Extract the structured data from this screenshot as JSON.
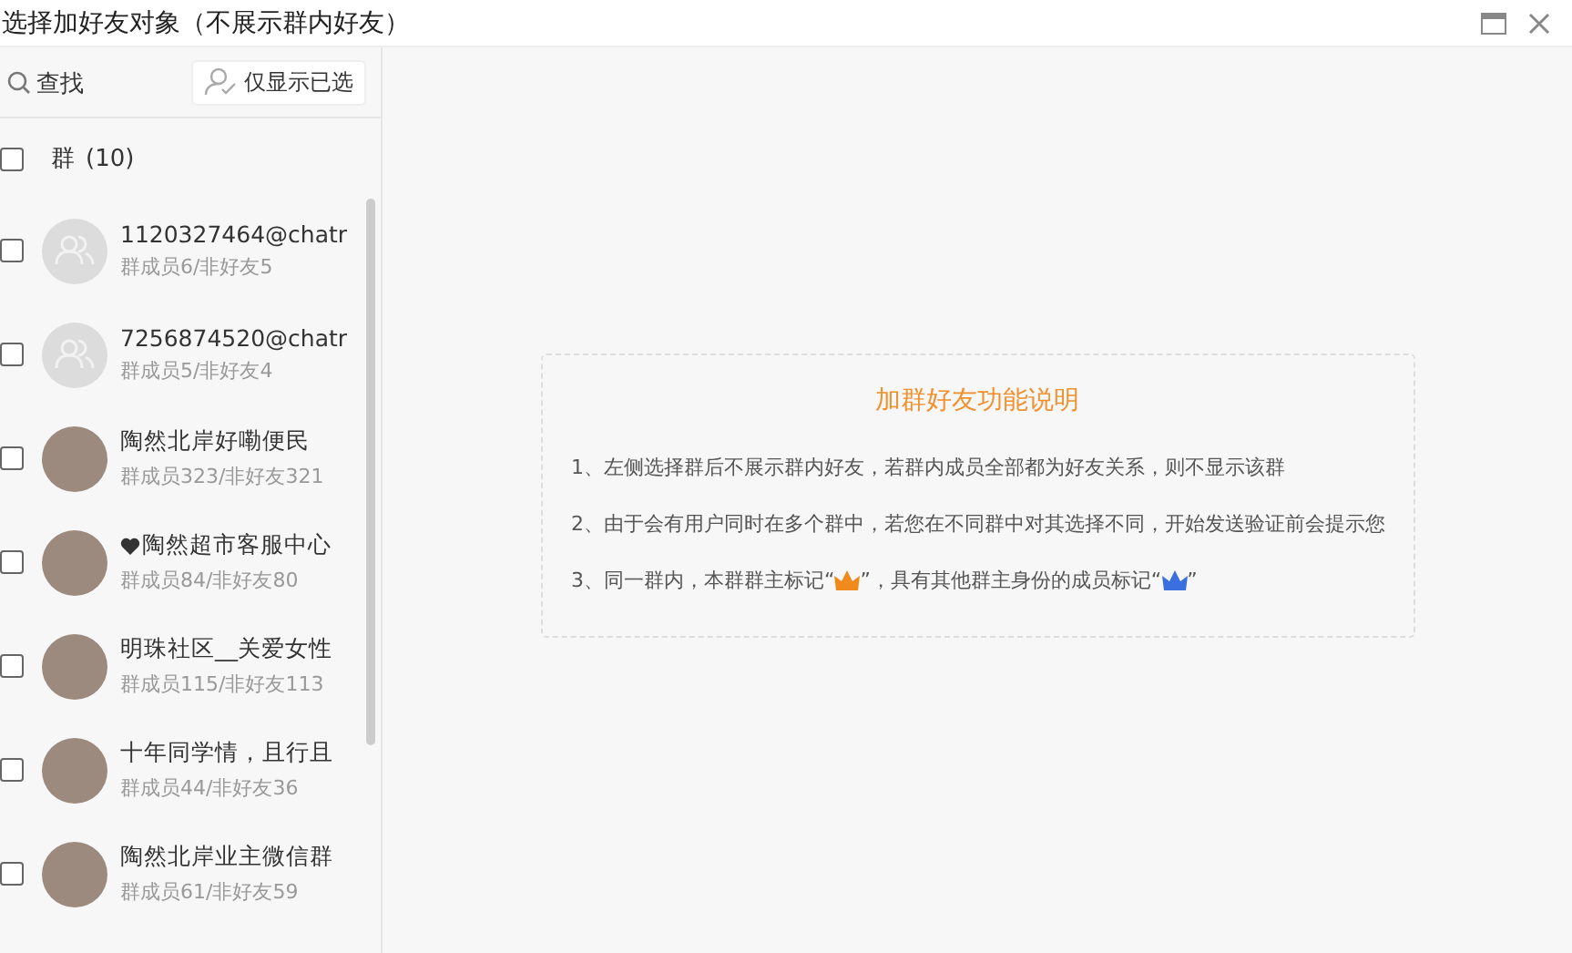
{
  "window": {
    "title": "选择加好友对象（不展示群内好友）"
  },
  "search": {
    "placeholder": "查找"
  },
  "filter_button": {
    "label": "仅显示已选"
  },
  "group_header": {
    "label": "群",
    "count": "(10)",
    "checked": false
  },
  "groups": [
    {
      "name": "1120327464@chatr",
      "stats": "群成员6/非好友5",
      "kind": "default",
      "checked": false,
      "heart": false
    },
    {
      "name": "7256874520@chatr",
      "stats": "群成员5/非好友4",
      "kind": "default",
      "checked": false,
      "heart": false
    },
    {
      "name": "陶然北岸好嘞便民",
      "stats": "群成员323/非好友321",
      "kind": "photo",
      "checked": false,
      "heart": false
    },
    {
      "name": "陶然超市客服中心",
      "stats": "群成员84/非好友80",
      "kind": "photo",
      "checked": false,
      "heart": true
    },
    {
      "name": "明珠社区__关爱女性",
      "stats": "群成员115/非好友113",
      "kind": "photo",
      "checked": false,
      "heart": false
    },
    {
      "name": "十年同学情，且行且",
      "stats": "群成员44/非好友36",
      "kind": "photo",
      "checked": false,
      "heart": false
    },
    {
      "name": "陶然北岸业主微信群",
      "stats": "群成员61/非好友59",
      "kind": "photo",
      "checked": false,
      "heart": false
    }
  ],
  "info_card": {
    "title": "加群好友功能说明",
    "lines": [
      [
        {
          "kind": "text",
          "text": "1、左侧选择群后不展示群内好友，若群内成员全部都为好友关系，则不显示该群"
        }
      ],
      [
        {
          "kind": "text",
          "text": "2、由于会有用户同时在多个群中，若您在不同群中对其选择不同，开始发送验证前会提示您"
        }
      ],
      [
        {
          "kind": "text",
          "text": "3、同一群内，本群群主标记“"
        },
        {
          "kind": "crown",
          "color": "#f08a1c"
        },
        {
          "kind": "text",
          "text": "”，具有其他群主身份的成员标记“"
        },
        {
          "kind": "crown",
          "color": "#3b6fe0"
        },
        {
          "kind": "text",
          "text": "”"
        }
      ]
    ]
  }
}
